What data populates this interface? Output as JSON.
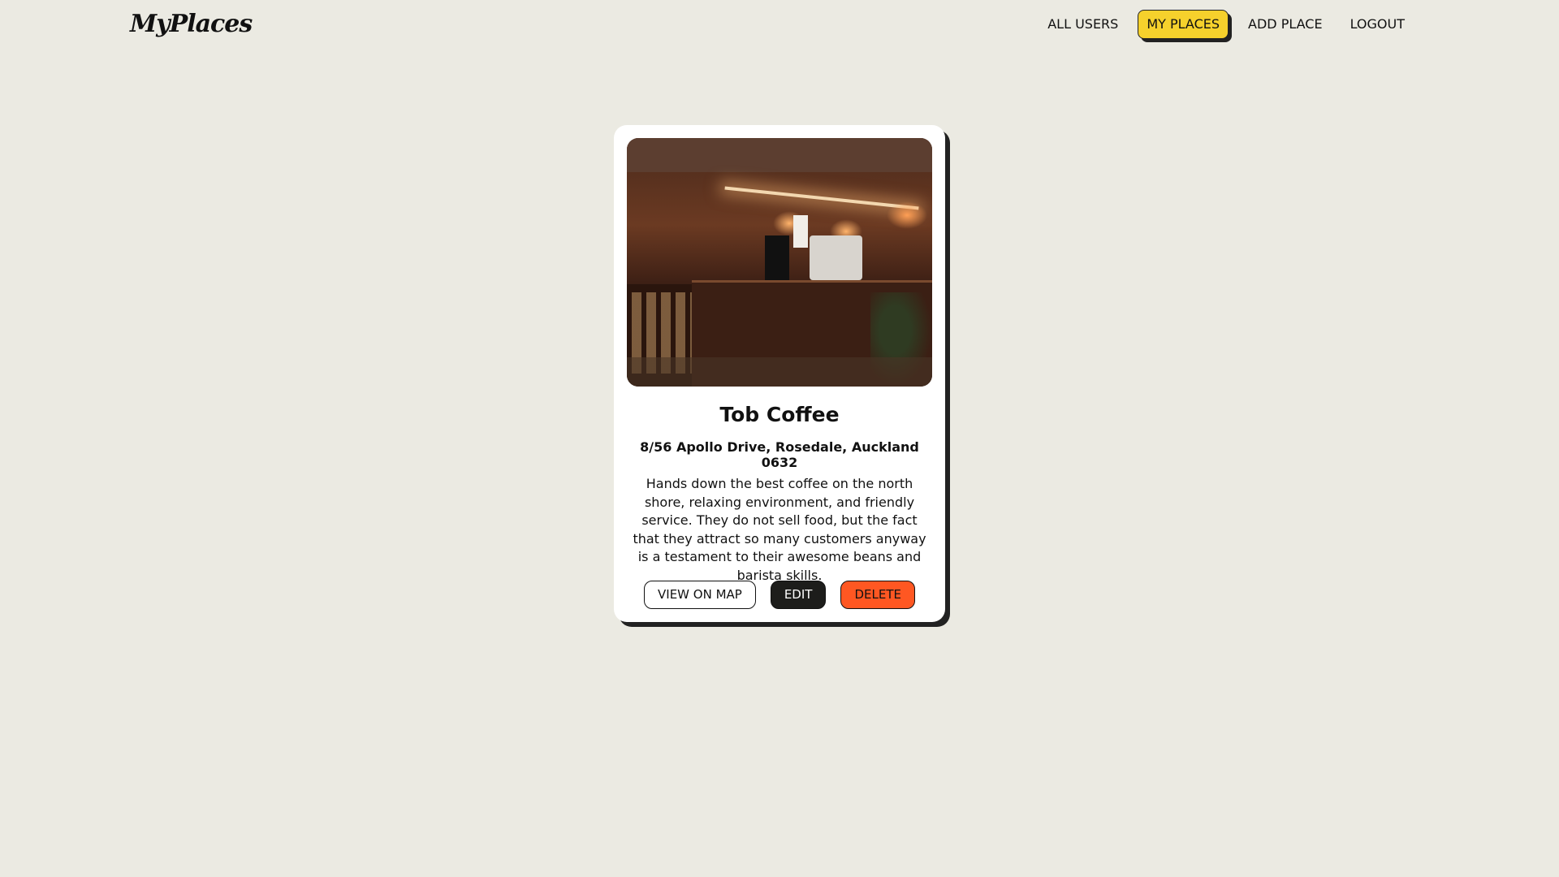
{
  "app": {
    "logo": "MyPlaces"
  },
  "nav": {
    "items": [
      {
        "label": "ALL USERS",
        "active": false
      },
      {
        "label": "MY PLACES",
        "active": true
      },
      {
        "label": "ADD PLACE",
        "active": false
      },
      {
        "label": "LOGOUT",
        "active": false
      }
    ]
  },
  "place": {
    "image_alt": "cafe-interior-photo",
    "title": "Tob Coffee",
    "address": "8/56 Apollo Drive, Rosedale, Auckland 0632",
    "description": "Hands down the best coffee on the north shore, relaxing environment, and friendly service. They do not sell food, but the fact that they attract so many customers anyway is a testament to their awesome beans and barista skills.",
    "actions": {
      "view_label": "VIEW ON MAP",
      "edit_label": "EDIT",
      "delete_label": "DELETE"
    }
  },
  "colors": {
    "background": "#ebeae2",
    "active_nav": "#f6d12c",
    "delete": "#ff5722",
    "edit": "#1d1d1b"
  }
}
